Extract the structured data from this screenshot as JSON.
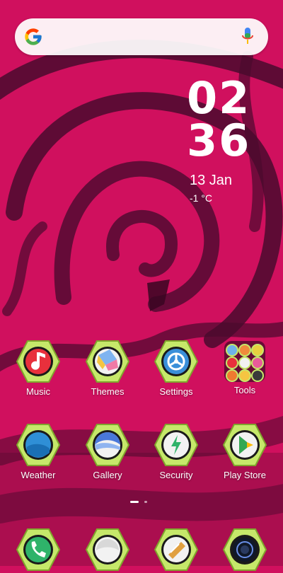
{
  "status_bar": {},
  "search": {
    "google_icon": "google-g-icon",
    "mic_icon": "microphone-icon"
  },
  "clock": {
    "hours": "02",
    "minutes": "36"
  },
  "date": "13 Jan",
  "weather": {
    "temperature": "-1 °C"
  },
  "apps_row1": [
    {
      "label": "Music",
      "icon": "music-icon"
    },
    {
      "label": "Themes",
      "icon": "themes-icon"
    },
    {
      "label": "Settings",
      "icon": "settings-icon"
    },
    {
      "label": "Tools",
      "icon": "folder-icon"
    }
  ],
  "apps_row2": [
    {
      "label": "Weather",
      "icon": "weather-icon"
    },
    {
      "label": "Gallery",
      "icon": "gallery-icon"
    },
    {
      "label": "Security",
      "icon": "security-icon"
    },
    {
      "label": "Play Store",
      "icon": "play-store-icon"
    }
  ],
  "dock": [
    {
      "icon": "phone-icon"
    },
    {
      "icon": "messages-icon"
    },
    {
      "icon": "notes-icon"
    },
    {
      "icon": "camera-icon"
    }
  ],
  "colors": {
    "wallpaper_primary": "#d0105e",
    "wallpaper_swirl": "#4a0a2e",
    "hex_frame": "#c6e86a",
    "text": "#ffffff"
  },
  "page_indicator": {
    "pages": 2,
    "current": 1
  }
}
